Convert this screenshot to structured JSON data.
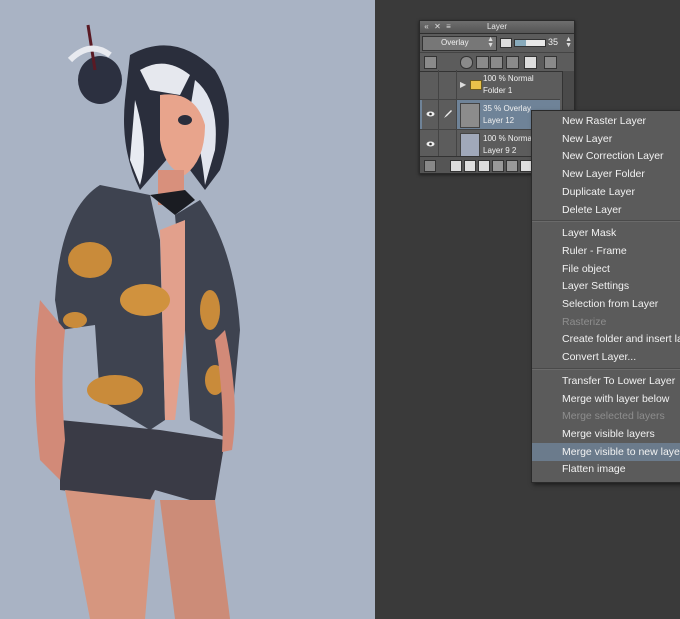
{
  "palette": {
    "title": "Layer",
    "blend_mode": "Overlay",
    "opacity_value": "35",
    "opacity_fraction": 0.35,
    "layers": [
      {
        "line1": "100 % Normal",
        "line2": "Folder 1",
        "type": "folder"
      },
      {
        "line1": "35 % Overlay",
        "line2": "Layer 12",
        "type": "raster",
        "selected": true
      },
      {
        "line1": "100 % Normal",
        "line2": "Layer 9 2",
        "type": "raster"
      }
    ]
  },
  "menu": {
    "groups": [
      [
        {
          "label": "New Raster Layer"
        },
        {
          "label": "New Layer"
        },
        {
          "label": "New Correction Layer"
        },
        {
          "label": "New Layer Folder"
        },
        {
          "label": "Duplicate Layer"
        },
        {
          "label": "Delete Layer"
        }
      ],
      [
        {
          "label": "Layer Mask"
        },
        {
          "label": "Ruler - Frame"
        },
        {
          "label": "File object"
        },
        {
          "label": "Layer Settings"
        },
        {
          "label": "Selection from Layer"
        },
        {
          "label": "Rasterize",
          "disabled": true
        },
        {
          "label": "Create folder and insert layer"
        },
        {
          "label": "Convert Layer..."
        }
      ],
      [
        {
          "label": "Transfer To Lower Layer"
        },
        {
          "label": "Merge with layer below"
        },
        {
          "label": "Merge selected layers",
          "disabled": true
        },
        {
          "label": "Merge visible layers"
        },
        {
          "label": "Merge visible to new layer",
          "hover": true
        },
        {
          "label": "Flatten image"
        }
      ]
    ]
  },
  "colors": {
    "canvas_bg": "#a9b3c4",
    "app_bg": "#3a3a3a",
    "menu_bg": "#5b5b5b",
    "menu_hover": "#6b7b8c",
    "selected_layer": "#6f8398"
  }
}
